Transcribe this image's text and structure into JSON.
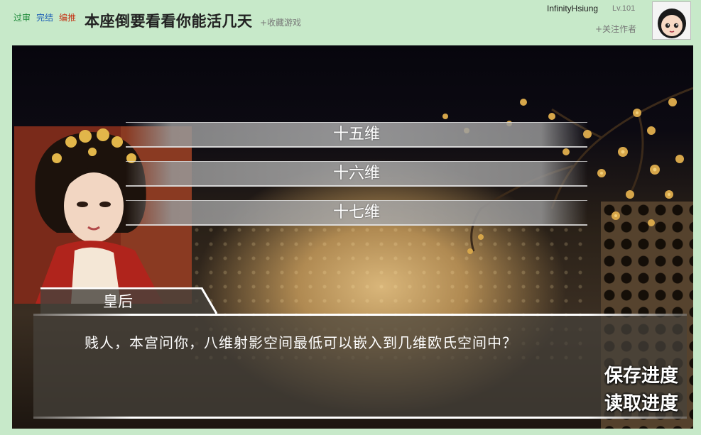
{
  "header": {
    "badges": [
      "过审",
      "完结",
      "编推"
    ],
    "title": "本座倒要看看你能活几天",
    "favorite_label": "+收藏游戏",
    "username": "InfinityHsiung",
    "level": "Lv.101",
    "follow_label": "+关注作者"
  },
  "game": {
    "choices": [
      "十五维",
      "十六维",
      "十七维"
    ],
    "speaker": "皇后",
    "dialogue": "贱人，本宫问你，八维射影空间最低可以嵌入到几维欧氏空间中？",
    "save_label": "保存进度",
    "load_label": "读取进度"
  },
  "colors": {
    "page_background": "#c7e9c9",
    "choice_bar": "#a6a6a6",
    "dialog_box": "#46423c"
  }
}
